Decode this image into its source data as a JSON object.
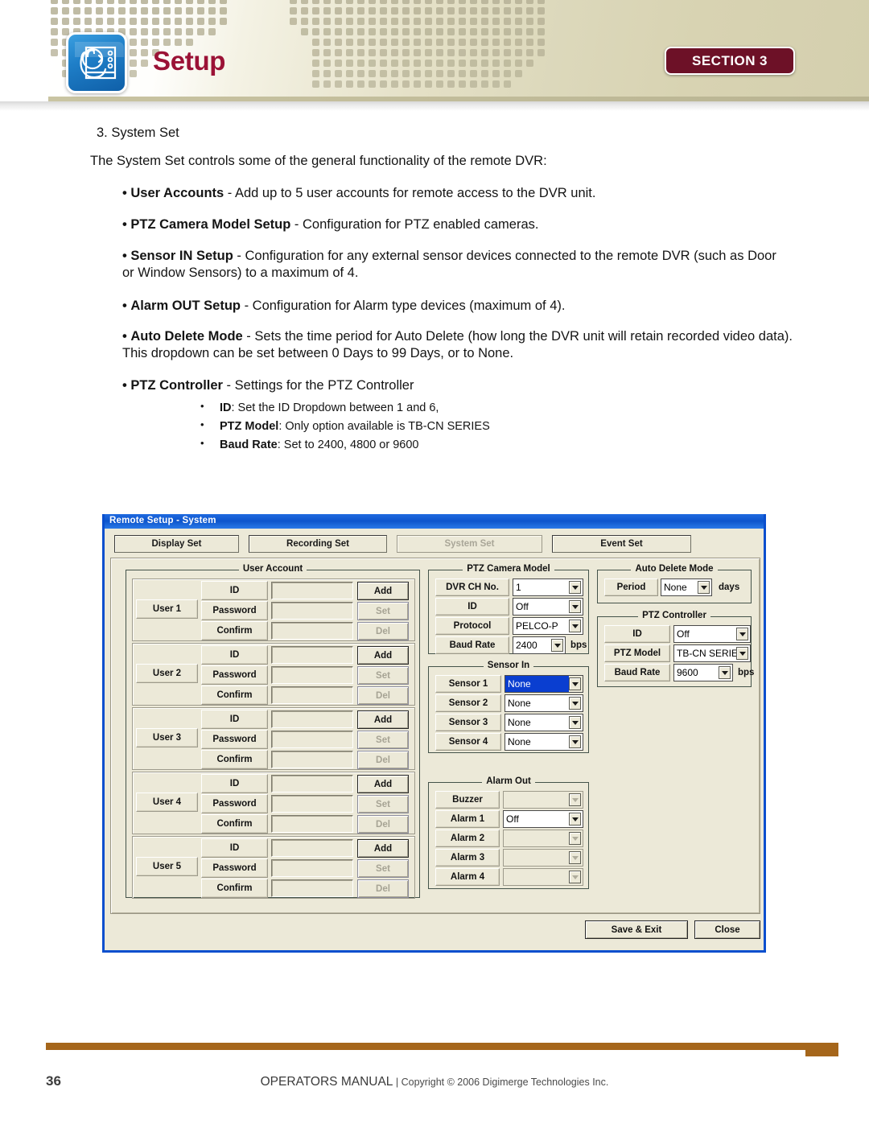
{
  "header": {
    "title": "Setup",
    "badge_label": "SECTION",
    "badge_number": "3",
    "icon_name": "setup-hand-screen-icon",
    "accent_color": "#9b1236",
    "badge_color": "#6d1127"
  },
  "body": {
    "heading": "3. System Set",
    "intro": "The System Set controls some of the general functionality of the remote DVR:",
    "bullets": [
      {
        "term": "User Accounts",
        "rest": " - Add up to 5 user accounts for remote access to the DVR unit."
      },
      {
        "term": "PTZ Camera Model Setup",
        "rest": " - Configuration for PTZ enabled cameras."
      },
      {
        "term": "Sensor IN Setup",
        "rest": " - Configuration for any external sensor devices connected to the remote DVR (such as Door or Window Sensors) to a maximum of 4."
      },
      {
        "term": "Alarm OUT Setup",
        "rest": " - Configuration for Alarm type devices (maximum of 4)."
      },
      {
        "term": "Auto Delete Mode",
        "rest": " - Sets the time period for Auto Delete (how long the DVR unit will retain recorded video data). This dropdown can be set between 0 Days to 99 Days, or to None."
      },
      {
        "term": "PTZ Controller",
        "rest": " - Settings for the PTZ Controller"
      }
    ],
    "sub_bullets": [
      {
        "term": "ID",
        "rest": ": Set the ID Dropdown between 1 and 6,"
      },
      {
        "term": "PTZ Model",
        "rest": ": Only option available is TB-CN SERIES"
      },
      {
        "term": "Baud Rate",
        "rest": ": Set to 2400, 4800 or 9600"
      }
    ]
  },
  "dialog": {
    "title": "Remote Setup - System",
    "tabs": [
      {
        "label": "Display Set",
        "disabled": false
      },
      {
        "label": "Recording Set",
        "disabled": false
      },
      {
        "label": "System Set",
        "disabled": true
      },
      {
        "label": "Event Set",
        "disabled": false
      }
    ],
    "user_account": {
      "group_title": "User Account",
      "row_labels": [
        "ID",
        "Password",
        "Confirm"
      ],
      "buttons": [
        "Add",
        "Set",
        "Del"
      ],
      "users": [
        {
          "name": "User 1",
          "id": "",
          "password": "",
          "confirm": ""
        },
        {
          "name": "User 2",
          "id": "",
          "password": "",
          "confirm": ""
        },
        {
          "name": "User 3",
          "id": "",
          "password": "",
          "confirm": ""
        },
        {
          "name": "User 4",
          "id": "",
          "password": "",
          "confirm": ""
        },
        {
          "name": "User 5",
          "id": "",
          "password": "",
          "confirm": ""
        }
      ]
    },
    "ptz_camera_model": {
      "group_title": "PTZ Camera Model",
      "rows": [
        {
          "label": "DVR CH No.",
          "value": "1",
          "unit": ""
        },
        {
          "label": "ID",
          "value": "Off",
          "unit": ""
        },
        {
          "label": "Protocol",
          "value": "PELCO-P",
          "unit": ""
        },
        {
          "label": "Baud Rate",
          "value": "2400",
          "unit": "bps"
        }
      ]
    },
    "sensor_in": {
      "group_title": "Sensor In",
      "rows": [
        {
          "label": "Sensor 1",
          "value": "None",
          "selected": true
        },
        {
          "label": "Sensor 2",
          "value": "None",
          "selected": false
        },
        {
          "label": "Sensor 3",
          "value": "None",
          "selected": false
        },
        {
          "label": "Sensor 4",
          "value": "None",
          "selected": false
        }
      ]
    },
    "alarm_out": {
      "group_title": "Alarm Out",
      "rows": [
        {
          "label": "Buzzer",
          "value": "",
          "disabled": true
        },
        {
          "label": "Alarm 1",
          "value": "Off",
          "disabled": false
        },
        {
          "label": "Alarm 2",
          "value": "",
          "disabled": true
        },
        {
          "label": "Alarm 3",
          "value": "",
          "disabled": true
        },
        {
          "label": "Alarm 4",
          "value": "",
          "disabled": true
        }
      ]
    },
    "auto_delete_mode": {
      "group_title": "Auto Delete Mode",
      "label": "Period",
      "value": "None",
      "unit": "days"
    },
    "ptz_controller": {
      "group_title": "PTZ Controller",
      "rows": [
        {
          "label": "ID",
          "value": "Off",
          "unit": ""
        },
        {
          "label": "PTZ Model",
          "value": "TB-CN SERIES",
          "unit": ""
        },
        {
          "label": "Baud Rate",
          "value": "9600",
          "unit": "bps"
        }
      ]
    },
    "actions": {
      "save": "Save & Exit",
      "close": "Close"
    }
  },
  "footer": {
    "page_number": "36",
    "manual": "OPERATORS MANUAL",
    "separator": " | ",
    "copyright": "Copyright © 2006 Digimerge Technologies Inc."
  }
}
